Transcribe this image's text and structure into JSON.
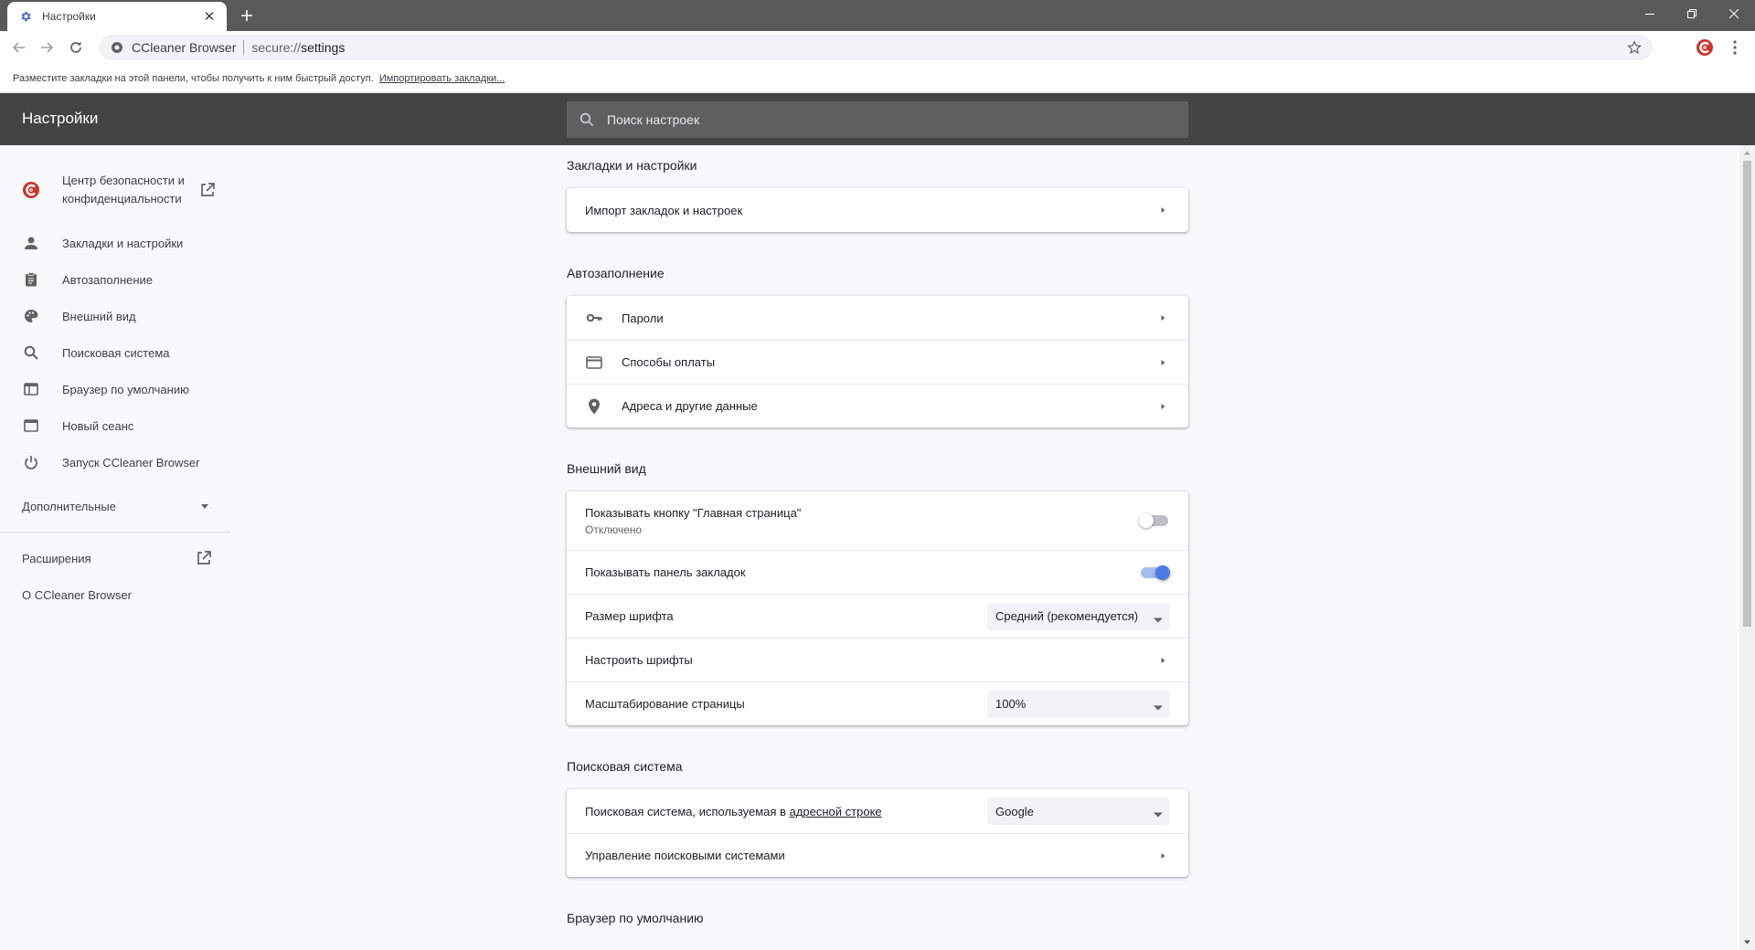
{
  "browser": {
    "tab_title": "Настройки",
    "new_tab_icon": "plus-icon",
    "window_controls": [
      "minimize-icon",
      "restore-icon",
      "close-icon"
    ],
    "site_name": "CCleaner Browser",
    "url_scheme": "secure://",
    "url_path": "settings",
    "bookmarks_bar_text": "Разместите закладки на этой панели, чтобы получить к ним быстрый доступ.",
    "bookmarks_bar_link": "Импортировать закладки...",
    "accent_color": "#4c7be0"
  },
  "header": {
    "title": "Настройки",
    "search_placeholder": "Поиск настроек"
  },
  "sidebar": {
    "items": [
      {
        "label": "Центр безопасности и конфиденциальности",
        "icon": "ccleaner-logo-icon",
        "external": true
      },
      {
        "label": "Закладки и настройки",
        "icon": "person-icon"
      },
      {
        "label": "Автозаполнение",
        "icon": "clipboard-icon"
      },
      {
        "label": "Внешний вид",
        "icon": "palette-icon"
      },
      {
        "label": "Поисковая система",
        "icon": "search-icon"
      },
      {
        "label": "Браузер по умолчанию",
        "icon": "browser-window-icon"
      },
      {
        "label": "Новый сеанс",
        "icon": "new-window-icon"
      },
      {
        "label": "Запуск CCleaner Browser",
        "icon": "power-icon"
      }
    ],
    "advanced_label": "Дополнительные",
    "extensions_label": "Расширения",
    "about_label": "О CCleaner Browser"
  },
  "sections": {
    "bookmarks": {
      "title": "Закладки и настройки",
      "import_label": "Импорт закладок и настроек"
    },
    "autofill": {
      "title": "Автозаполнение",
      "passwords_label": "Пароли",
      "payments_label": "Способы оплаты",
      "addresses_label": "Адреса и другие данные"
    },
    "appearance": {
      "title": "Внешний вид",
      "home_button_label": "Показывать кнопку \"Главная страница\"",
      "home_button_sub": "Отключено",
      "home_button_on": false,
      "bookmarks_bar_label": "Показывать панель закладок",
      "bookmarks_bar_on": true,
      "font_size_label": "Размер шрифта",
      "font_size_value": "Средний (рекомендуется)",
      "customize_fonts_label": "Настроить шрифты",
      "zoom_label": "Масштабирование страницы",
      "zoom_value": "100%"
    },
    "search": {
      "title": "Поисковая система",
      "engine_label_prefix": "Поисковая система, используемая в",
      "engine_label_link": "адресной строке",
      "engine_value": "Google",
      "manage_label": "Управление поисковыми системами"
    },
    "default_browser": {
      "title": "Браузер по умолчанию"
    }
  }
}
